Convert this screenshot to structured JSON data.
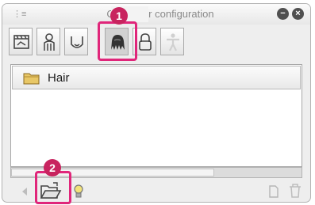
{
  "window": {
    "title": "Character configuration",
    "minimize_icon": "collapse-icon",
    "close_icon": "close-icon"
  },
  "tabs": [
    {
      "icon": "film-clapper-icon"
    },
    {
      "icon": "body-icon"
    },
    {
      "icon": "face-icon"
    },
    {
      "icon": "hair-icon",
      "active": true
    },
    {
      "icon": "accessory-icon"
    },
    {
      "icon": "figure-icon",
      "disabled": true
    }
  ],
  "list": {
    "items": [
      {
        "label": "Hair",
        "icon": "folder-icon"
      }
    ]
  },
  "bottom_bar": {
    "left_icons": [
      "arrow-left-icon",
      "open-folder-icon",
      "lightbulb-icon"
    ],
    "right_icons": [
      "new-page-icon",
      "trash-icon"
    ]
  },
  "callouts": [
    "1",
    "2"
  ],
  "colors": {
    "highlight": "#e0267a",
    "marker": "#c8245f"
  }
}
